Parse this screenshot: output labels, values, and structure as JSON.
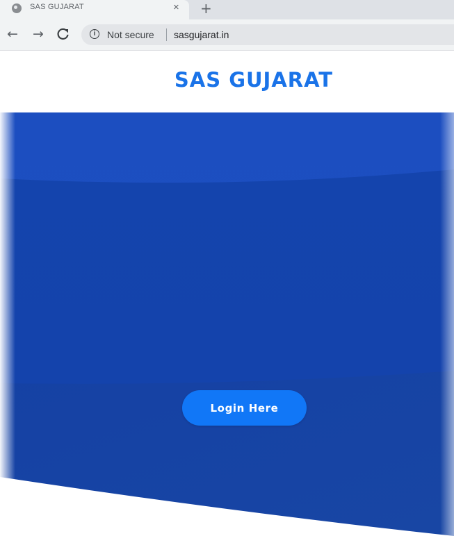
{
  "browser": {
    "tab": {
      "title": "SAS GUJARAT",
      "close_glyph": "×",
      "favicon": "globe-icon"
    },
    "new_tab_glyph": "+",
    "nav": {
      "back_glyph": "←",
      "forward_glyph": "→",
      "reload_glyph": "C"
    },
    "omnibox": {
      "security_label": "Not secure",
      "info_glyph": "i",
      "url": "sasgujarat.in"
    }
  },
  "site": {
    "title": "SAS GUJARAT",
    "login_label": "Login Here"
  },
  "colors": {
    "title": "#1a73e8",
    "hero_top": "#1d4fc2",
    "hero_mid": "#1443ad",
    "hero_bottom": "#1542a0",
    "button": "#1177f7"
  }
}
